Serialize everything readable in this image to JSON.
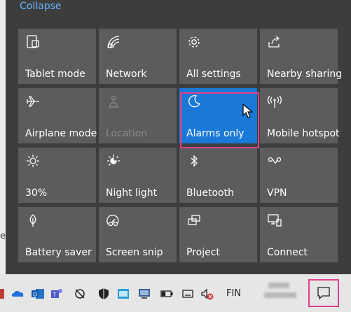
{
  "action_center": {
    "collapse_label": "Collapse",
    "tiles": [
      {
        "label": "Tablet mode",
        "icon": "tablet-mode-icon",
        "state": "off"
      },
      {
        "label": "Network",
        "icon": "network-icon",
        "state": "off"
      },
      {
        "label": "All settings",
        "icon": "gear-icon",
        "state": "off"
      },
      {
        "label": "Nearby sharing",
        "icon": "nearby-sharing-icon",
        "state": "off"
      },
      {
        "label": "Airplane mode",
        "icon": "airplane-icon",
        "state": "off"
      },
      {
        "label": "Location",
        "icon": "location-icon",
        "state": "disabled"
      },
      {
        "label": "Alarms only",
        "icon": "moon-icon",
        "state": "active"
      },
      {
        "label": "Mobile hotspot",
        "icon": "hotspot-icon",
        "state": "off"
      },
      {
        "label": "30%",
        "icon": "brightness-icon",
        "state": "off"
      },
      {
        "label": "Night light",
        "icon": "night-light-icon",
        "state": "off"
      },
      {
        "label": "Bluetooth",
        "icon": "bluetooth-icon",
        "state": "off"
      },
      {
        "label": "VPN",
        "icon": "vpn-icon",
        "state": "off"
      },
      {
        "label": "Battery saver",
        "icon": "battery-saver-icon",
        "state": "off"
      },
      {
        "label": "Screen snip",
        "icon": "screen-snip-icon",
        "state": "off"
      },
      {
        "label": "Project",
        "icon": "project-icon",
        "state": "off"
      },
      {
        "label": "Connect",
        "icon": "connect-icon",
        "state": "off"
      }
    ]
  },
  "taskbar": {
    "language": "FIN"
  },
  "colors": {
    "accent": "#1a78d7",
    "highlight": "#e0408a",
    "tile_bg": "#5c5c5c",
    "panel_bg": "#3d3d3d"
  }
}
